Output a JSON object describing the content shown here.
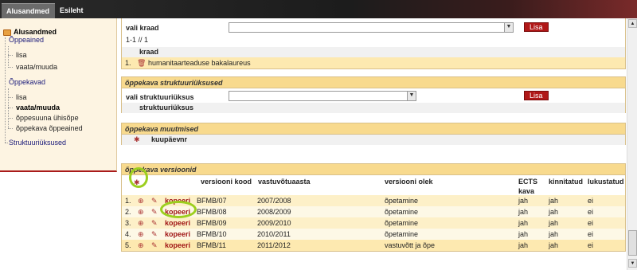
{
  "tabs": {
    "alusandmed": "Alusandmed",
    "esileht": "Esileht"
  },
  "sidebar": {
    "root": "Alusandmed",
    "groups": [
      {
        "label": "Õppeained",
        "items": [
          "lisa",
          "vaata/muuda"
        ]
      },
      {
        "label": "Õppekavad",
        "items": [
          "lisa",
          "vaata/muuda",
          "õppesuuna ühisõpe",
          "õppekava õppeained"
        ]
      },
      {
        "label": "Struktuuriüksused",
        "items": []
      }
    ]
  },
  "kraad": {
    "select_label": "vali kraad",
    "button": "Lisa",
    "counter": "1-1 // 1",
    "column": "kraad",
    "rows": [
      {
        "n": "1.",
        "value": "humanitaarteaduse bakalaureus"
      }
    ]
  },
  "struktuur": {
    "title": "õppekava struktuuriüksused",
    "select_label": "vali struktuuriüksus",
    "button": "Lisa",
    "column": "struktuuriüksus"
  },
  "muutmised": {
    "title": "õppekava muutmised",
    "columns": [
      "kuupäev",
      "nr"
    ]
  },
  "versioonid": {
    "title": "õppekava versioonid",
    "columns": [
      "versiooni kood",
      "vastuvõtuaasta",
      "versiooni olek",
      "ECTS kava",
      "kinnitatud",
      "lukustatud"
    ],
    "copy_label": "kopeeri",
    "rows": [
      {
        "n": "1.",
        "kood": "BFMB/07",
        "aasta": "2007/2008",
        "olek": "õpetamine",
        "ects": "jah",
        "kinnitatud": "jah",
        "lukustatud": "ei"
      },
      {
        "n": "2.",
        "kood": "BFMB/08",
        "aasta": "2008/2009",
        "olek": "õpetamine",
        "ects": "jah",
        "kinnitatud": "jah",
        "lukustatud": "ei"
      },
      {
        "n": "3.",
        "kood": "BFMB/09",
        "aasta": "2009/2010",
        "olek": "õpetamine",
        "ects": "jah",
        "kinnitatud": "jah",
        "lukustatud": "ei"
      },
      {
        "n": "4.",
        "kood": "BFMB/10",
        "aasta": "2010/2011",
        "olek": "õpetamine",
        "ects": "jah",
        "kinnitatud": "jah",
        "lukustatud": "ei"
      },
      {
        "n": "5.",
        "kood": "BFMB/11",
        "aasta": "2011/2012",
        "olek": "vastuvõtt ja õpe",
        "ects": "jah",
        "kinnitatud": "jah",
        "lukustatud": "ei"
      }
    ]
  }
}
